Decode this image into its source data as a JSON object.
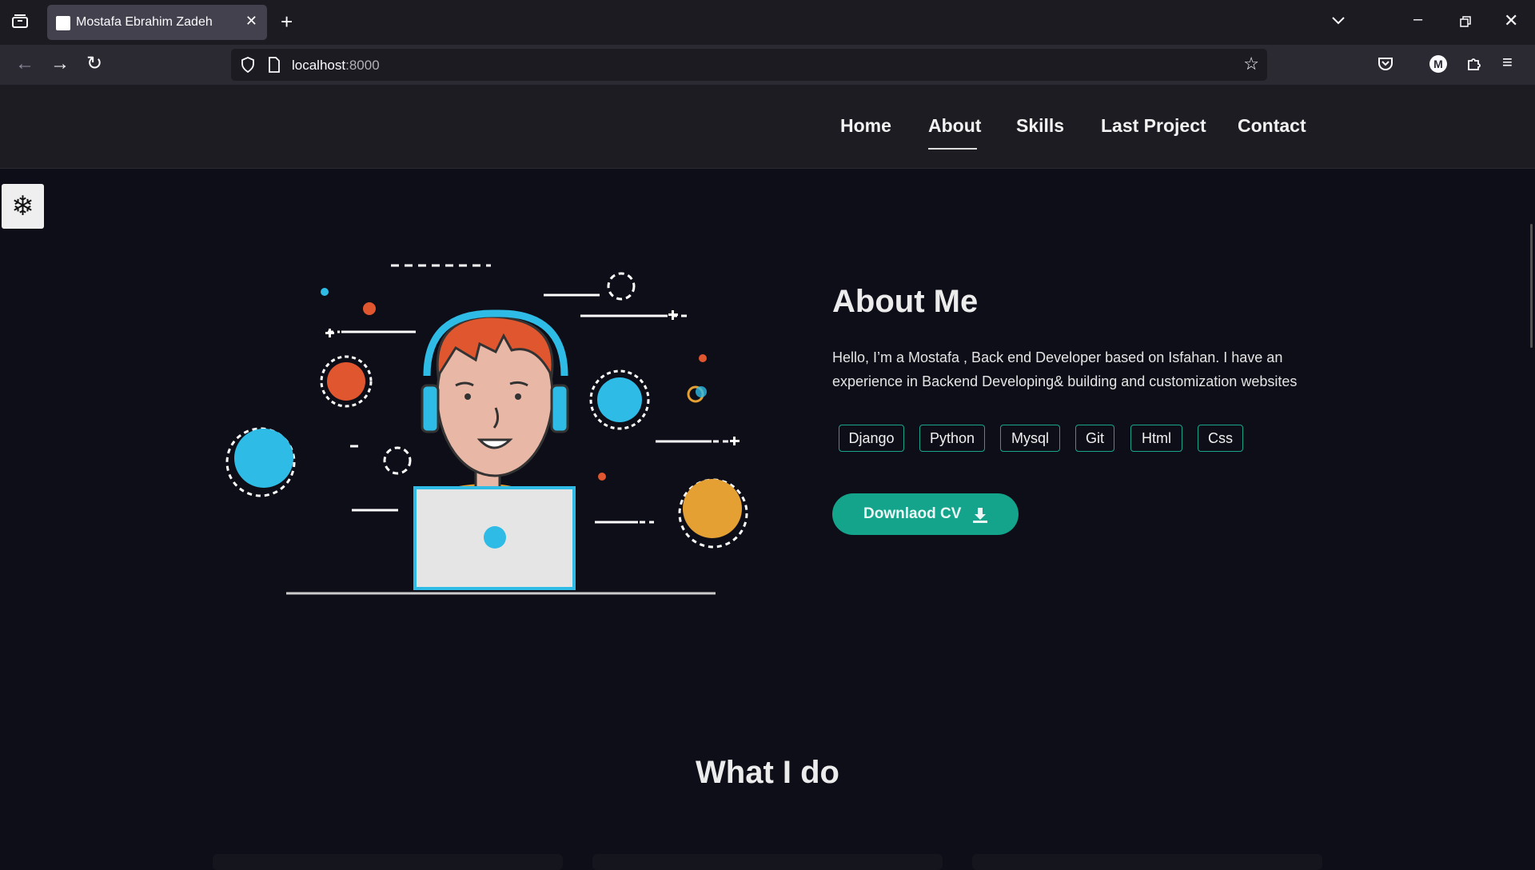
{
  "browser": {
    "tab_title": "Mostafa Ebrahim Zadeh",
    "url_host": "localhost",
    "url_port": ":8000",
    "icons": [
      "tab-list-icon",
      "close-icon",
      "plus-icon",
      "chevron-down-icon",
      "minimize-icon",
      "restore-icon",
      "window-close-icon",
      "back-icon",
      "forward-icon",
      "reload-icon",
      "shield-icon",
      "page-icon",
      "star-icon",
      "pocket-icon",
      "account-icon",
      "extensions-icon",
      "menu-icon"
    ],
    "account_initial": "M"
  },
  "nav": {
    "links": [
      "Home",
      "About",
      "Skills",
      "Last Project",
      "Contact"
    ],
    "active": "About"
  },
  "theme_toggle": {
    "icon": "snowflake-icon"
  },
  "about": {
    "title": "About Me",
    "text": "Hello, I’m a Mostafa , Back end Developer based on Isfahan. I have an experience in Backend Developing& building and customization websites",
    "tags": [
      "Django",
      "Python",
      "Mysql",
      "Git",
      "Html",
      "Css"
    ],
    "cv_button": "Downlaod CV",
    "cv_icon": "download-icon"
  },
  "services": {
    "title": "What I do"
  },
  "colors": {
    "accent": "#14a48b",
    "background": "#0e0e18",
    "header": "#1c1c22",
    "orange": "#e0562f",
    "blue": "#2ebce6",
    "yellow": "#e5a033"
  }
}
